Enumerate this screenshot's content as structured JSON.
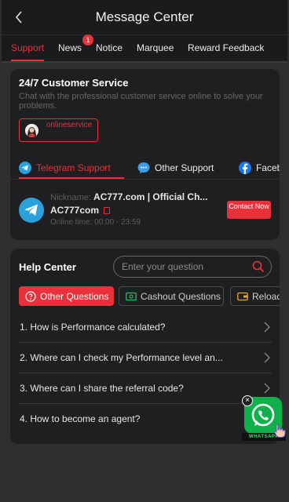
{
  "header": {
    "title": "Message Center"
  },
  "tabs": [
    {
      "label": "Support",
      "active": true
    },
    {
      "label": "News",
      "badge": "1"
    },
    {
      "label": "Notice"
    },
    {
      "label": "Marquee"
    },
    {
      "label": "Reward Feedback"
    }
  ],
  "customer_service": {
    "title": "24/7 Customer Service",
    "subtitle": "Chat with the professional customer service online to solve your problems.",
    "agent_name": "onlineservice",
    "channels": [
      {
        "label": "Telegram Support",
        "icon": "telegram-icon",
        "active": true
      },
      {
        "label": "Other Support",
        "icon": "chat-icon"
      },
      {
        "label": "Facebook",
        "icon": "facebook-icon"
      }
    ],
    "contact": {
      "nickname_label": "Nickname:",
      "nickname": "AC777.com | Official Ch...",
      "handle": "AC777com",
      "hours_label": "Online time:",
      "hours": "00:00 - 23:59",
      "button_label": "Contact Now"
    }
  },
  "help_center": {
    "title": "Help Center",
    "search_placeholder": "Enter your question",
    "categories": [
      {
        "label": "Other Questions",
        "active": true
      },
      {
        "label": "Cashout Questions"
      },
      {
        "label": "Reload Questions"
      }
    ],
    "questions": [
      "1. How is Performance calculated?",
      "2. Where can I check my Performance level an...",
      "3. Where can I share the referral code?",
      "4. How to become an agent?"
    ]
  },
  "whatsapp_widget": {
    "label": "WHATSAPP",
    "close": "×"
  },
  "colors": {
    "accent": "#e8313a",
    "background": "#2f2f32",
    "card": "#1f1f21",
    "telegram": "#2aa1dc",
    "whatsapp": "#0fb24a"
  }
}
